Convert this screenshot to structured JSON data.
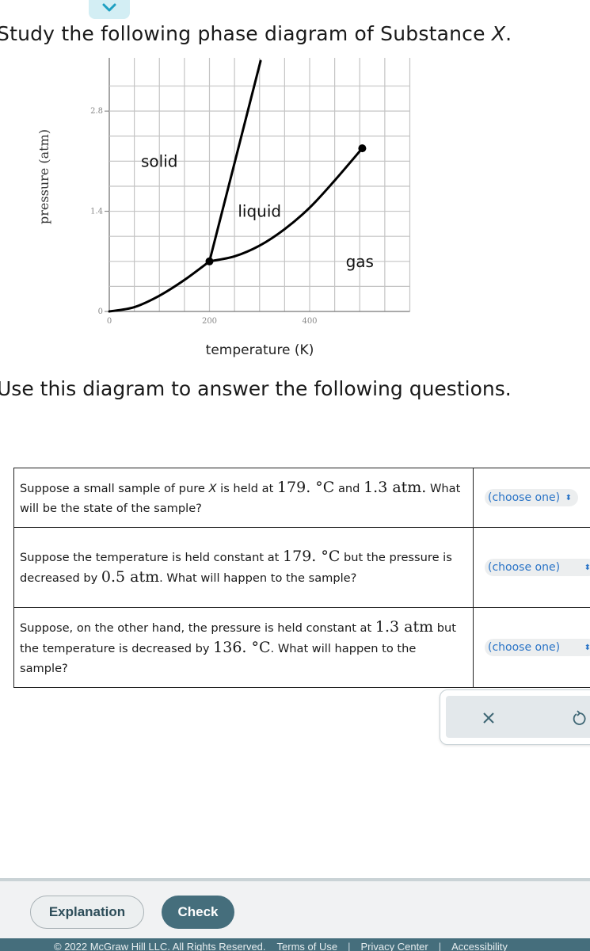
{
  "collapse_toggle": {
    "icon": "chevron-down-icon",
    "color": "#1ea0c2"
  },
  "intro": {
    "before": "Study the following phase diagram of Substance ",
    "var": "X",
    "after": "."
  },
  "chart_data": {
    "type": "line",
    "title": "",
    "xlabel": "temperature (K)",
    "ylabel": "pressure (atm)",
    "xlim": [
      0,
      600
    ],
    "ylim": [
      0,
      3.5
    ],
    "x_ticks": [
      0,
      200,
      400
    ],
    "x_tick_labels": [
      "0",
      "200",
      "400"
    ],
    "y_ticks": [
      0,
      1.4,
      2.8
    ],
    "y_tick_labels": [
      "0",
      "1.4",
      "2.8"
    ],
    "x_grid_step": 50,
    "y_grid_step": 0.35,
    "grid": true,
    "region_labels": [
      {
        "text": "solid",
        "x": 100,
        "y": 2.1
      },
      {
        "text": "liquid",
        "x": 300,
        "y": 1.4
      },
      {
        "text": "gas",
        "x": 500,
        "y": 0.7
      }
    ],
    "series": [
      {
        "name": "sublimation curve",
        "points": [
          [
            0,
            0
          ],
          [
            50,
            0.06
          ],
          [
            100,
            0.22
          ],
          [
            150,
            0.44
          ],
          [
            200,
            0.7
          ]
        ]
      },
      {
        "name": "melting curve",
        "points": [
          [
            200,
            0.7
          ],
          [
            302,
            3.5
          ]
        ]
      },
      {
        "name": "vaporization curve",
        "points": [
          [
            200,
            0.7
          ],
          [
            250,
            0.77
          ],
          [
            300,
            0.92
          ],
          [
            350,
            1.15
          ],
          [
            400,
            1.45
          ],
          [
            450,
            1.83
          ],
          [
            505,
            2.28
          ]
        ]
      }
    ],
    "special_points": [
      {
        "name": "triple point",
        "x": 200,
        "y": 0.7
      },
      {
        "name": "critical point",
        "x": 505,
        "y": 2.28
      }
    ]
  },
  "use_text": "Use this diagram to answer the following questions.",
  "questions": [
    {
      "parts": [
        {
          "t": "Suppose a small sample of pure "
        },
        {
          "t": "X",
          "i": true
        },
        {
          "t": " is held at "
        },
        {
          "t": "179. °C",
          "n": true
        },
        {
          "t": " and "
        },
        {
          "t": "1.3 atm.",
          "n": true
        },
        {
          "t": " What will be the state of the sample?"
        }
      ],
      "select": {
        "value": "(choose one)",
        "icon": "up-down-arrows-icon"
      }
    },
    {
      "parts": [
        {
          "t": "Suppose the temperature is held constant at "
        },
        {
          "t": "179. °C",
          "n": true
        },
        {
          "t": " but the pressure is decreased by "
        },
        {
          "t": "0.5 atm",
          "n": true
        },
        {
          "t": ". What will happen to the sample?"
        }
      ],
      "select": {
        "value": "(choose one)",
        "icon": "up-down-arrows-icon"
      }
    },
    {
      "parts": [
        {
          "t": "Suppose, on the other hand, the pressure is held constant at "
        },
        {
          "t": "1.3 atm",
          "n": true
        },
        {
          "t": " but the temperature is decreased by "
        },
        {
          "t": "136. °C",
          "n": true
        },
        {
          "t": ". What will happen to the sample?"
        }
      ],
      "select": {
        "value": "(choose one)",
        "icon": "up-down-arrows-icon"
      }
    }
  ],
  "tools": {
    "clear_icon": "x-icon",
    "undo_icon": "undo-icon",
    "color": "#3e6674"
  },
  "actions": {
    "explanation_label": "Explanation",
    "check_label": "Check"
  },
  "footer": {
    "copyright": "© 2022 McGraw Hill LLC. All Rights Reserved.",
    "links": [
      "Terms of Use",
      "Privacy Center",
      "Accessibility"
    ]
  }
}
